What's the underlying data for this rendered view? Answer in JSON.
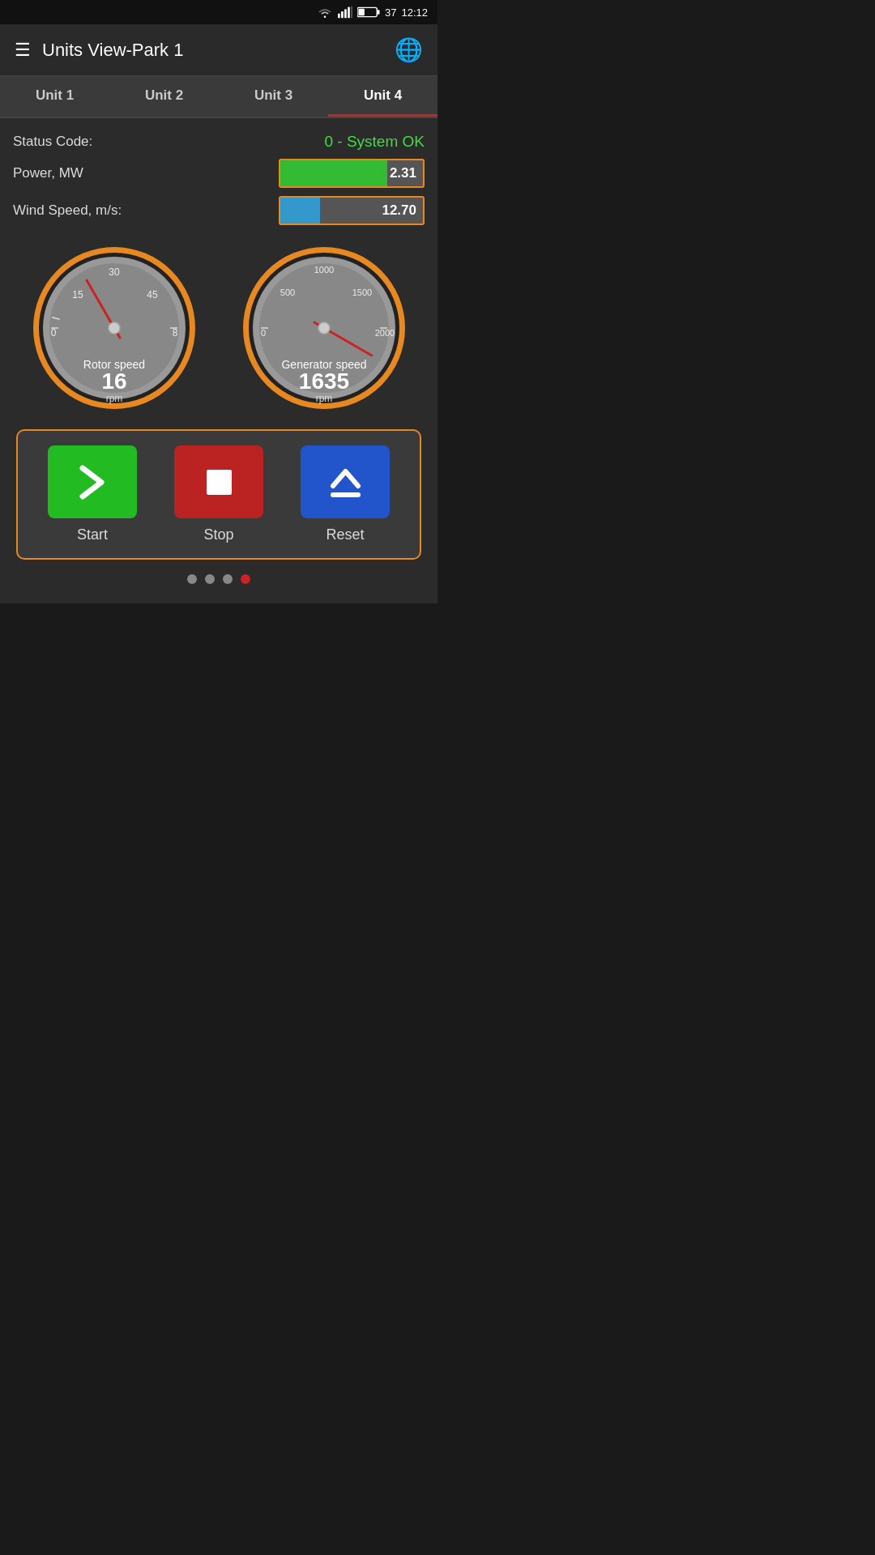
{
  "statusBar": {
    "time": "12:12",
    "battery": "37"
  },
  "header": {
    "title": "Units View-Park 1",
    "menu_icon": "☰",
    "globe_icon": "🌐"
  },
  "tabs": [
    {
      "label": "Unit 1",
      "active": false
    },
    {
      "label": "Unit 2",
      "active": false
    },
    {
      "label": "Unit 3",
      "active": false
    },
    {
      "label": "Unit 4",
      "active": true
    }
  ],
  "statusInfo": {
    "statusCodeLabel": "Status Code:",
    "statusCodeValue": "0 - System OK",
    "powerLabel": "Power, MW",
    "powerValue": "2.31",
    "powerBarPercent": 75,
    "windSpeedLabel": "Wind Speed, m/s:",
    "windSpeedValue": "12.70",
    "windBarPercent": 28
  },
  "rotorGauge": {
    "label": "Rotor speed",
    "value": "16",
    "unit": "rpm",
    "needleAngle": -55
  },
  "generatorGauge": {
    "label": "Generator speed",
    "value": "1635",
    "unit": "rpm",
    "needleAngle": 30
  },
  "buttons": {
    "start": {
      "label": "Start"
    },
    "stop": {
      "label": "Stop"
    },
    "reset": {
      "label": "Reset"
    }
  },
  "pageDots": [
    false,
    false,
    false,
    true
  ]
}
